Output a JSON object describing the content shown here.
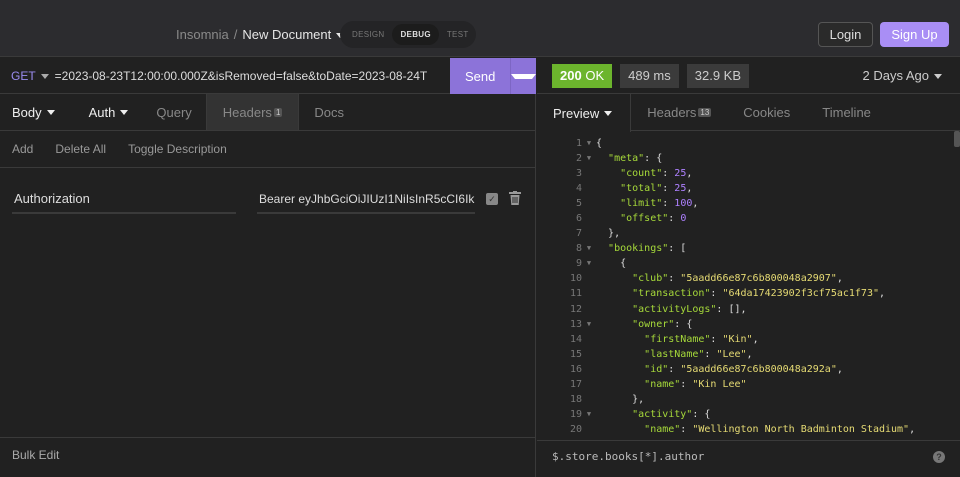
{
  "top": {
    "app": "Insomnia",
    "sep": "/",
    "document": "New Document",
    "modes": [
      "DESIGN",
      "DEBUG",
      "TEST"
    ],
    "active_mode": "DEBUG",
    "login": "Login",
    "signup": "Sign Up"
  },
  "request": {
    "method": "GET",
    "url": "=2023-08-23T12:00:00.000Z&isRemoved=false&toDate=2023-08-24T",
    "send": "Send"
  },
  "req_tabs": {
    "body": "Body",
    "auth": "Auth",
    "query": "Query",
    "headers": "Headers",
    "headers_count": "1",
    "docs": "Docs"
  },
  "actions": {
    "add": "Add",
    "delete_all": "Delete All",
    "toggle": "Toggle Description"
  },
  "header_row": {
    "name": "Authorization",
    "value": "Bearer eyJhbGciOiJIUzI1NiIsInR5cCI6Ik",
    "enabled": true
  },
  "bulk_edit": "Bulk Edit",
  "response": {
    "status_code": "200",
    "status_text": "OK",
    "time": "489 ms",
    "size": "32.9 KB",
    "history": "2 Days Ago",
    "tabs": {
      "preview": "Preview",
      "headers": "Headers",
      "headers_count": "13",
      "cookies": "Cookies",
      "timeline": "Timeline"
    },
    "filter": "$.store.books[*].author",
    "help": "?"
  },
  "code_lines": [
    {
      "n": "1",
      "f": true,
      "i": 0,
      "t": [
        [
          "p",
          "{"
        ]
      ]
    },
    {
      "n": "2",
      "f": true,
      "i": 1,
      "t": [
        [
          "k",
          "\"meta\""
        ],
        [
          "p",
          ": {"
        ]
      ]
    },
    {
      "n": "3",
      "i": 2,
      "t": [
        [
          "k",
          "\"count\""
        ],
        [
          "p",
          ": "
        ],
        [
          "n",
          "25"
        ],
        [
          "p",
          ","
        ]
      ]
    },
    {
      "n": "4",
      "i": 2,
      "t": [
        [
          "k",
          "\"total\""
        ],
        [
          "p",
          ": "
        ],
        [
          "n",
          "25"
        ],
        [
          "p",
          ","
        ]
      ]
    },
    {
      "n": "5",
      "i": 2,
      "t": [
        [
          "k",
          "\"limit\""
        ],
        [
          "p",
          ": "
        ],
        [
          "n",
          "100"
        ],
        [
          "p",
          ","
        ]
      ]
    },
    {
      "n": "6",
      "i": 2,
      "t": [
        [
          "k",
          "\"offset\""
        ],
        [
          "p",
          ": "
        ],
        [
          "n",
          "0"
        ]
      ]
    },
    {
      "n": "7",
      "i": 1,
      "t": [
        [
          "p",
          "},"
        ]
      ]
    },
    {
      "n": "8",
      "f": true,
      "i": 1,
      "t": [
        [
          "k",
          "\"bookings\""
        ],
        [
          "p",
          ": ["
        ]
      ]
    },
    {
      "n": "9",
      "f": true,
      "i": 2,
      "t": [
        [
          "p",
          "{"
        ]
      ]
    },
    {
      "n": "10",
      "i": 3,
      "t": [
        [
          "k",
          "\"club\""
        ],
        [
          "p",
          ": "
        ],
        [
          "s",
          "\"5aadd66e87c6b800048a2907\""
        ],
        [
          "p",
          ","
        ]
      ]
    },
    {
      "n": "11",
      "i": 3,
      "t": [
        [
          "k",
          "\"transaction\""
        ],
        [
          "p",
          ": "
        ],
        [
          "s",
          "\"64da17423902f3cf75ac1f73\""
        ],
        [
          "p",
          ","
        ]
      ]
    },
    {
      "n": "12",
      "i": 3,
      "t": [
        [
          "k",
          "\"activityLogs\""
        ],
        [
          "p",
          ": [],"
        ]
      ]
    },
    {
      "n": "13",
      "f": true,
      "i": 3,
      "t": [
        [
          "k",
          "\"owner\""
        ],
        [
          "p",
          ": {"
        ]
      ]
    },
    {
      "n": "14",
      "i": 4,
      "t": [
        [
          "k",
          "\"firstName\""
        ],
        [
          "p",
          ": "
        ],
        [
          "s",
          "\"Kin\""
        ],
        [
          "p",
          ","
        ]
      ]
    },
    {
      "n": "15",
      "i": 4,
      "t": [
        [
          "k",
          "\"lastName\""
        ],
        [
          "p",
          ": "
        ],
        [
          "s",
          "\"Lee\""
        ],
        [
          "p",
          ","
        ]
      ]
    },
    {
      "n": "16",
      "i": 4,
      "t": [
        [
          "k",
          "\"id\""
        ],
        [
          "p",
          ": "
        ],
        [
          "s",
          "\"5aadd66e87c6b800048a292a\""
        ],
        [
          "p",
          ","
        ]
      ]
    },
    {
      "n": "17",
      "i": 4,
      "t": [
        [
          "k",
          "\"name\""
        ],
        [
          "p",
          ": "
        ],
        [
          "s",
          "\"Kin Lee\""
        ]
      ]
    },
    {
      "n": "18",
      "i": 3,
      "t": [
        [
          "p",
          "},"
        ]
      ]
    },
    {
      "n": "19",
      "f": true,
      "i": 3,
      "t": [
        [
          "k",
          "\"activity\""
        ],
        [
          "p",
          ": {"
        ]
      ]
    },
    {
      "n": "20",
      "i": 4,
      "t": [
        [
          "k",
          "\"name\""
        ],
        [
          "p",
          ": "
        ],
        [
          "s",
          "\"Wellington North Badminton Stadium\""
        ],
        [
          "p",
          ","
        ]
      ]
    }
  ]
}
